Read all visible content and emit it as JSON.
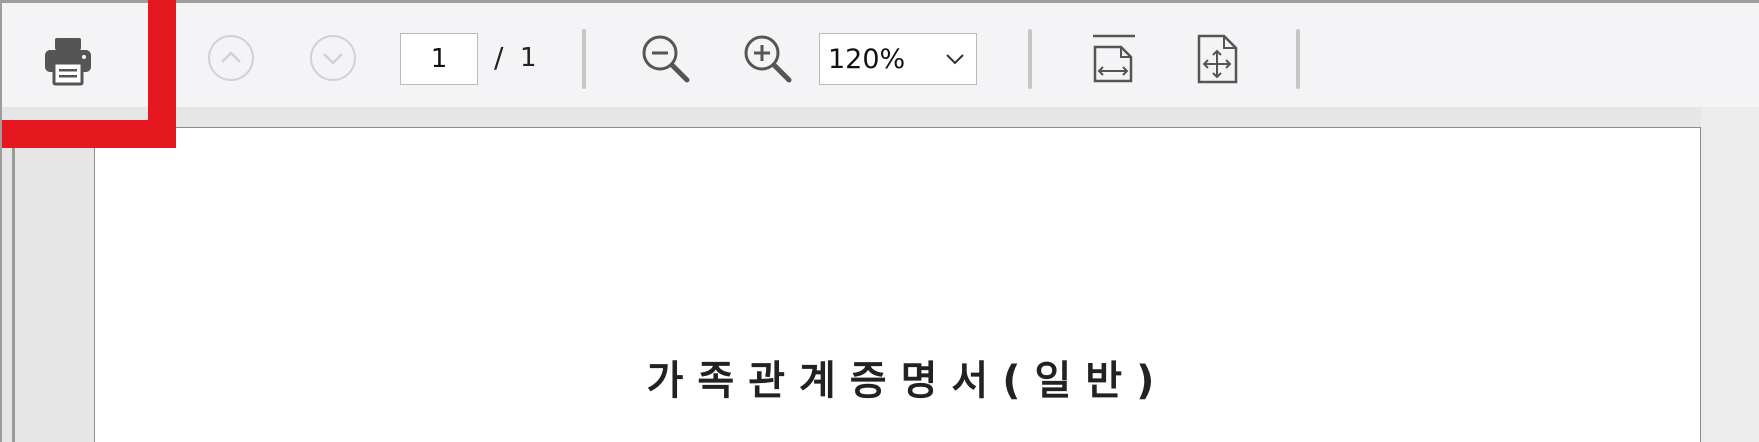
{
  "toolbar": {
    "print_icon": "printer-icon",
    "prev_icon": "chevron-up-circle-icon",
    "next_icon": "chevron-down-circle-icon",
    "page_current": "1",
    "page_separator": "/",
    "page_total": "1",
    "zoom_out_icon": "zoom-out-icon",
    "zoom_in_icon": "zoom-in-icon",
    "zoom_value": "120%",
    "fit_width_icon": "fit-width-icon",
    "fit_page_icon": "fit-page-icon"
  },
  "document": {
    "title": "가족관계증명서(일반)"
  },
  "colors": {
    "highlight": "#e5181f",
    "toolbar_bg": "#f4f4f6",
    "disabled_icon": "#cfcfd4",
    "icon": "#555555"
  }
}
